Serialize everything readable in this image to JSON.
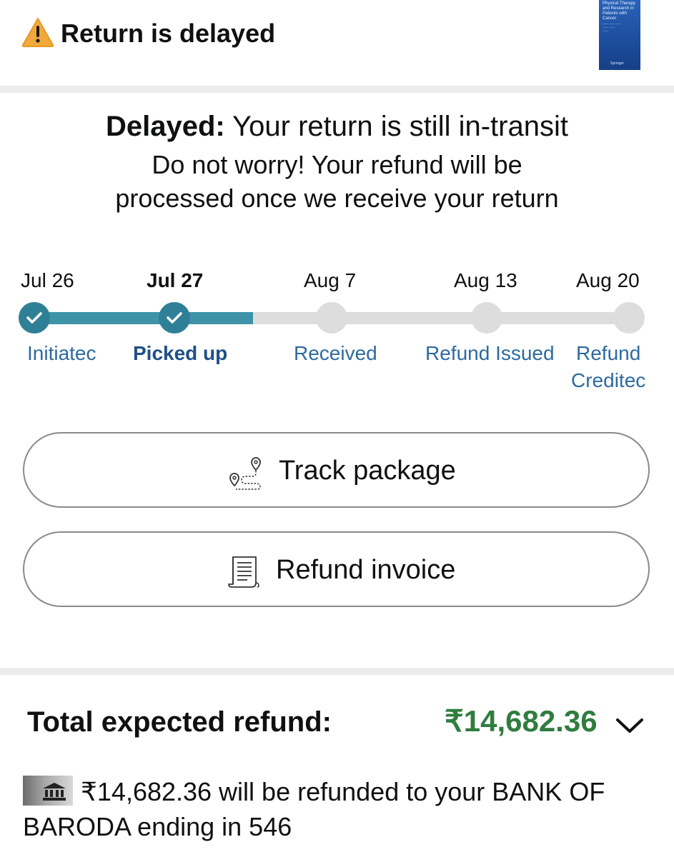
{
  "header": {
    "title": "Return is delayed",
    "warning_icon": "warning-triangle-icon",
    "product_thumbnail": {
      "title_text": "Physical Therapy and Research in Patients with Cancer",
      "publisher": "Springer"
    }
  },
  "status": {
    "headline_bold": "Delayed:",
    "headline_rest": " Your return is still in-transit",
    "line2": "Do not worry! Your refund will be",
    "line3": "processed once we receive your return"
  },
  "timeline": {
    "colors": {
      "done": "#2f7f97",
      "fill": "#3f93a8",
      "pending": "#dddddd",
      "label": "#2e6a9e"
    },
    "progress_fraction": 0.37,
    "steps": [
      {
        "date": "Jul 26",
        "label": "Initiatec",
        "status": "done"
      },
      {
        "date": "Jul 27",
        "label": "Picked up",
        "status": "done",
        "current": true
      },
      {
        "date": "Aug 7",
        "label": "Received",
        "status": "pending"
      },
      {
        "date": "Aug 13",
        "label": "Refund Issued",
        "status": "pending"
      },
      {
        "date": "Aug 20",
        "label_line1": "Refund",
        "label_line2": "Creditec",
        "status": "pending"
      }
    ]
  },
  "actions": {
    "track_package": {
      "label": "Track package",
      "icon": "map-route-icon"
    },
    "refund_invoice": {
      "label": "Refund invoice",
      "icon": "receipt-icon"
    }
  },
  "refund": {
    "label": "Total expected refund:",
    "amount": "₹14,682.36",
    "amount_color": "#2f7d3e",
    "bank_icon": "bank-icon",
    "line1": "₹14,682.36 will be refunded to your BANK OF",
    "line2": "BARODA ending in 546"
  }
}
